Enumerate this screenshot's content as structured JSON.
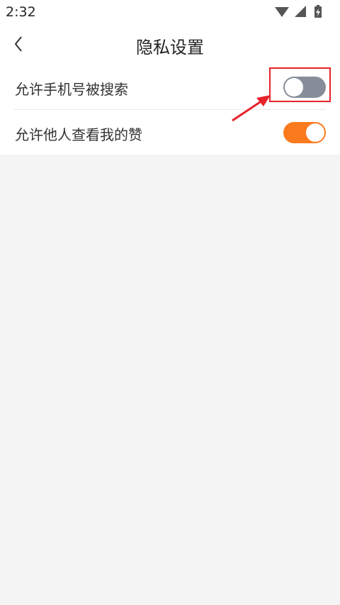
{
  "status_bar": {
    "time": "2:32",
    "icons": [
      "wifi-icon",
      "cell-signal-icon",
      "battery-charging-icon"
    ]
  },
  "header": {
    "title": "隐私设置",
    "back_icon": "chevron-left-icon"
  },
  "settings": [
    {
      "label": "允许手机号被搜索",
      "enabled": false
    },
    {
      "label": "允许他人查看我的赞",
      "enabled": true
    }
  ],
  "colors": {
    "toggle_on": "#fc7a1e",
    "toggle_off": "#878e99",
    "annotation": "#e8222b",
    "background": "#f4f4f4"
  }
}
